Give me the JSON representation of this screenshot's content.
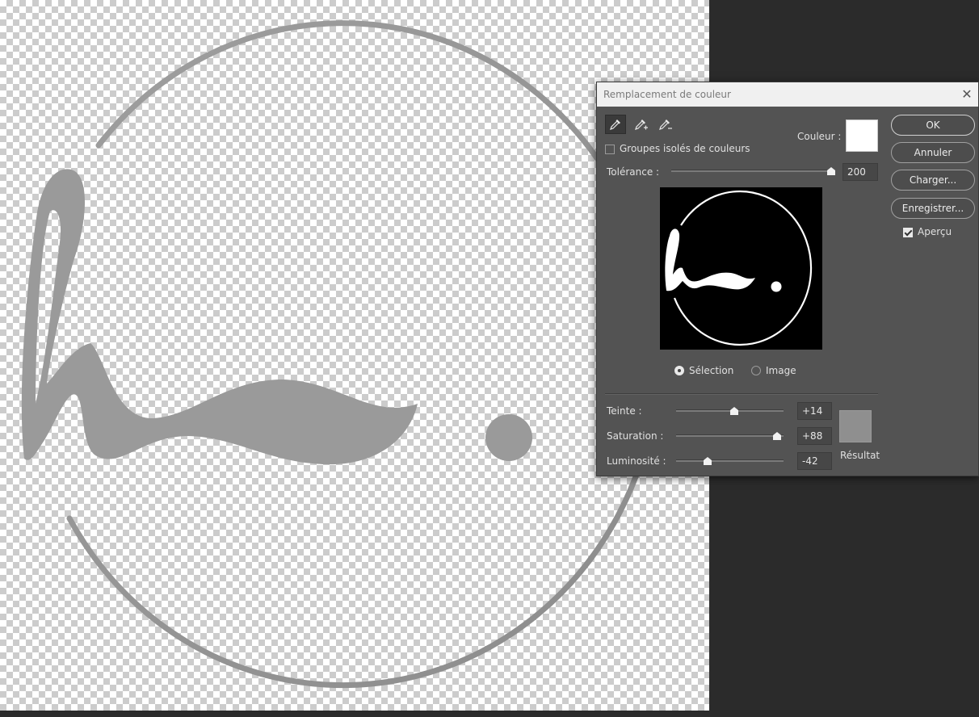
{
  "dialog": {
    "title": "Remplacement de couleur",
    "close_glyph": "✕",
    "tools": [
      {
        "name": "eyedropper-icon"
      },
      {
        "name": "eyedropper-plus-icon"
      },
      {
        "name": "eyedropper-minus-icon"
      }
    ],
    "couleur_label": "Couleur :",
    "couleur_color": "#ffffff",
    "groupes_label": "Groupes isolés de couleurs",
    "groupes_checked": false,
    "tolerance": {
      "label": "Tolérance :",
      "value": "200",
      "max": 200
    },
    "preview_mode": {
      "selection": "Sélection",
      "image": "Image",
      "selected": "selection"
    },
    "teinte": {
      "label": "Teinte :",
      "value": "+14",
      "min": -180,
      "max": 180
    },
    "saturation": {
      "label": "Saturation :",
      "value": "+88",
      "min": -100,
      "max": 100
    },
    "luminosite": {
      "label": "Luminosité :",
      "value": "-42",
      "min": -100,
      "max": 100
    },
    "resultat_label": "Résultat",
    "resultat_color": "#8f8f8f",
    "buttons": {
      "ok": "OK",
      "annuler": "Annuler",
      "charger": "Charger...",
      "enregistrer": "Enregistrer..."
    },
    "apercu_label": "Aperçu",
    "apercu_checked": true
  },
  "canvas": {
    "logo_color": "#9a9a9a"
  }
}
